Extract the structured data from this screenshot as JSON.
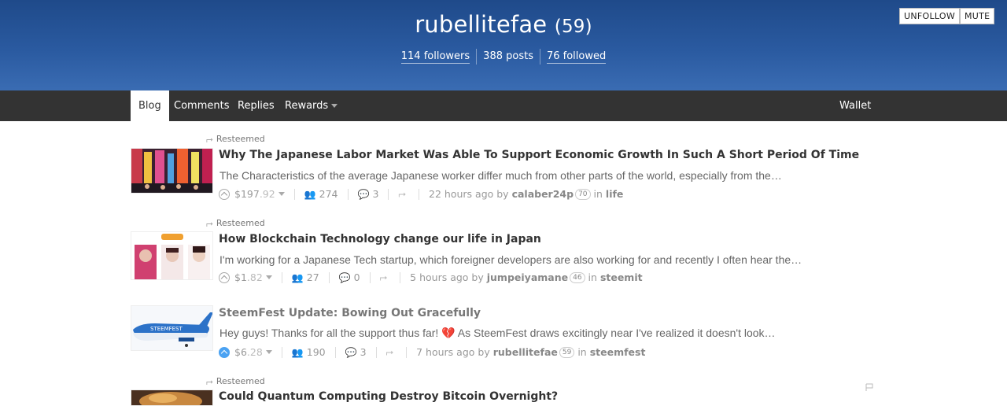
{
  "header": {
    "username": "rubellitefae",
    "reputation": "(59)",
    "followers": "114 followers",
    "posts": "388 posts",
    "followed": "76 followed",
    "unfollow_label": "UNFOLLOW",
    "mute_label": "MUTE",
    "background_color": "#2a5aa0"
  },
  "nav": {
    "tabs": [
      {
        "label": "Blog",
        "active": true
      },
      {
        "label": "Comments"
      },
      {
        "label": "Replies"
      },
      {
        "label": "Rewards"
      }
    ],
    "wallet_label": "Wallet"
  },
  "posts": [
    {
      "resteemed": "Resteemed",
      "title": "Why The Japanese Labor Market Was Able To Support Economic Growth In Such A Short Period Of Time",
      "body": "The Characteristics of the average Japanese worker differ much from other parts of the world, especially from the…",
      "payout_main": "$197",
      "payout_cents": ".92",
      "votes": "274",
      "comments": "3",
      "time": "22 hours ago by",
      "author": "calaber24p",
      "author_rep": "70",
      "in_label": "in",
      "category": "life",
      "voted": false
    },
    {
      "resteemed": "Resteemed",
      "title": "How Blockchain Technology change our life in Japan",
      "body": "I'm working for a Japanese Tech startup, which foreigner developers are also working for and recently I often hear the…",
      "payout_main": "$1",
      "payout_cents": ".82",
      "votes": "27",
      "comments": "0",
      "time": "5 hours ago by",
      "author": "jumpeiyamane",
      "author_rep": "46",
      "in_label": "in",
      "category": "steemit",
      "voted": false
    },
    {
      "title": "SteemFest Update: Bowing Out Gracefully",
      "body_before": "Hey guys! Thanks for all the support thus far!",
      "body_after": "As SteemFest draws excitingly near I've realized it doesn't look…",
      "payout_main": "$6",
      "payout_cents": ".28",
      "votes": "190",
      "comments": "3",
      "time": "7 hours ago by",
      "author": "rubellitefae",
      "author_rep": "59",
      "in_label": "in",
      "category": "steemfest",
      "voted": true
    },
    {
      "resteemed": "Resteemed",
      "title": "Could Quantum Computing Destroy Bitcoin Overnight?"
    }
  ],
  "thumb_texts": {
    "plane_text": "STEEMFEST"
  }
}
